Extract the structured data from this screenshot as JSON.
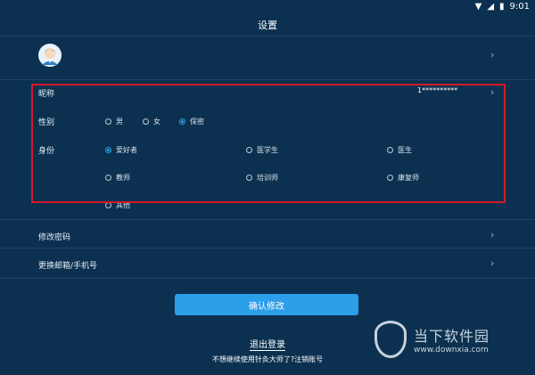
{
  "status_bar": {
    "time": "9:01"
  },
  "header": {
    "title": "设置"
  },
  "profile": {
    "chevron": "›"
  },
  "form": {
    "nickname": {
      "label": "昵称",
      "value": "1**********"
    },
    "gender": {
      "label": "性别",
      "options": [
        "男",
        "女",
        "保密"
      ],
      "selected": "保密"
    },
    "identity": {
      "label": "身份",
      "options": [
        "爱好者",
        "医学生",
        "医生",
        "教师",
        "培训师",
        "康复师",
        "其他"
      ],
      "selected": "爱好者"
    }
  },
  "menu": {
    "change_password": "修改密码",
    "change_contact": "更换邮箱/手机号"
  },
  "actions": {
    "confirm": "确认修改",
    "logout": "退出登录",
    "unsubscribe": "不想继续使用针灸大师了?注销账号"
  },
  "watermark": {
    "name": "当下软件园",
    "url": "www.downxia.com"
  },
  "colors": {
    "background": "#0c3150",
    "accent": "#2d9ee8",
    "highlight_box": "#d6182a"
  }
}
